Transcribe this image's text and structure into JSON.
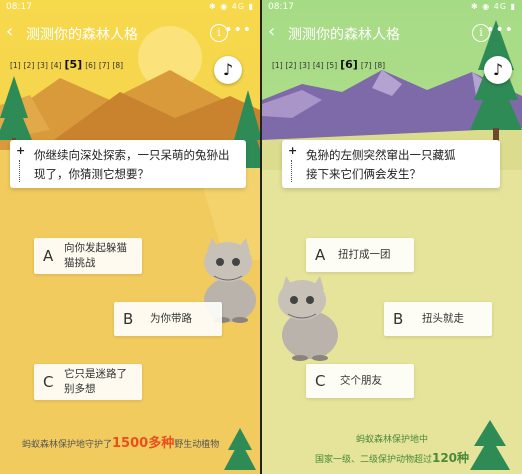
{
  "status": {
    "time": "08:17",
    "icons": "✱ ◉ 4G ▮"
  },
  "screens": [
    {
      "title": "测测你的森林人格",
      "pages": [
        "[1]",
        "[2]",
        "[3]",
        "[4]",
        "[5]",
        "[6]",
        "[7]",
        "[8]"
      ],
      "current_page": "[5]",
      "question": "你继续向深处探索，一只呆萌的兔狲出现了，你猜测它想要？",
      "options": [
        {
          "letter": "A",
          "text": "向你发起躲猫猫挑战"
        },
        {
          "letter": "B",
          "text": "为你带路"
        },
        {
          "letter": "C",
          "text": "它只是迷路了别多想"
        }
      ],
      "footer_pre": "蚂蚁森林保护地守护了",
      "footer_num": "1500多种",
      "footer_post": "野生动植物"
    },
    {
      "title": "测测你的森林人格",
      "pages": [
        "[1]",
        "[2]",
        "[3]",
        "[4]",
        "[5]",
        "[6]",
        "[7]",
        "[8]"
      ],
      "current_page": "[6]",
      "question": "兔狲的左侧突然窜出一只藏狐接下来它们俩会发生？",
      "options": [
        {
          "letter": "A",
          "text": "扭打成一团"
        },
        {
          "letter": "B",
          "text": "扭头就走"
        },
        {
          "letter": "C",
          "text": "交个朋友"
        }
      ],
      "footer_line1": "蚂蚁森林保护地中",
      "footer_pre": "国家一级、二级保护动物超过",
      "footer_num": "120种"
    }
  ],
  "colors": {
    "sky1": "#f5d34a",
    "sand": "#f1c95b",
    "sky2": "#9ed68a",
    "meadow": "#e8e59a"
  },
  "icons": {
    "back": "chevron-left-icon",
    "info": "info-icon",
    "more": "more-icon",
    "music": "music-note-icon"
  }
}
